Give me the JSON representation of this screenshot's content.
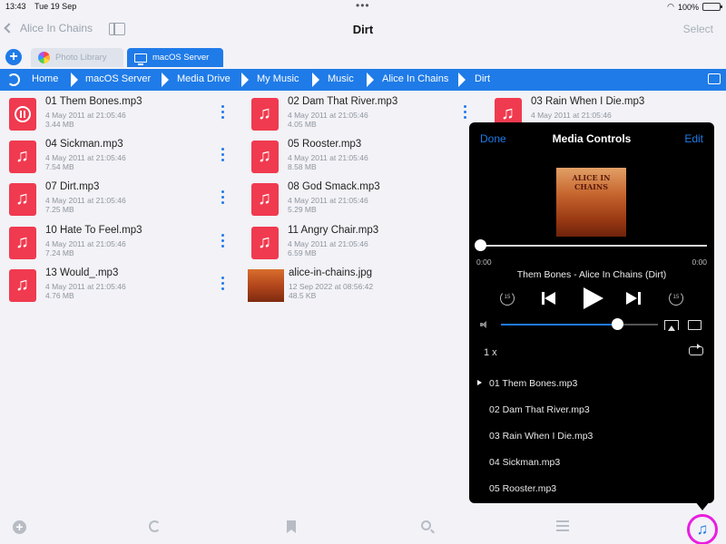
{
  "status": {
    "time": "13:43",
    "date": "Tue 19 Sep",
    "battery": "100%",
    "battery_level": 1.0
  },
  "nav": {
    "back_label": "Alice In Chains",
    "title": "Dirt",
    "select_label": "Select"
  },
  "tabs": [
    {
      "label": "Photo Library",
      "active": false
    },
    {
      "label": "macOS Server",
      "active": true
    }
  ],
  "breadcrumb": [
    "Home",
    "macOS Server",
    "Media Drive",
    "My Music",
    "Music",
    "Alice In Chains",
    "Dirt"
  ],
  "files": [
    {
      "name": "01 Them Bones.mp3",
      "date": "4 May 2011 at 21:05:46",
      "size": "3.44 MB",
      "type": "audio",
      "playing": true
    },
    {
      "name": "02 Dam That River.mp3",
      "date": "4 May 2011 at 21:05:46",
      "size": "4.05 MB",
      "type": "audio"
    },
    {
      "name": "03 Rain When I Die.mp3",
      "date": "4 May 2011 at 21:05:46",
      "size": "",
      "type": "audio"
    },
    {
      "name": "04 Sickman.mp3",
      "date": "4 May 2011 at 21:05:46",
      "size": "7.54 MB",
      "type": "audio"
    },
    {
      "name": "05 Rooster.mp3",
      "date": "4 May 2011 at 21:05:46",
      "size": "8.58 MB",
      "type": "audio"
    },
    {
      "name": "07 Dirt.mp3",
      "date": "4 May 2011 at 21:05:46",
      "size": "7.25 MB",
      "type": "audio"
    },
    {
      "name": "08 God Smack.mp3",
      "date": "4 May 2011 at 21:05:46",
      "size": "5.29 MB",
      "type": "audio"
    },
    {
      "name": "10 Hate To Feel.mp3",
      "date": "4 May 2011 at 21:05:46",
      "size": "7.24 MB",
      "type": "audio"
    },
    {
      "name": "11 Angry Chair.mp3",
      "date": "4 May 2011 at 21:05:46",
      "size": "6.59 MB",
      "type": "audio"
    },
    {
      "name": "13 Would_.mp3",
      "date": "4 May 2011 at 21:05:46",
      "size": "4.76 MB",
      "type": "audio"
    },
    {
      "name": "alice-in-chains.jpg",
      "date": "12 Sep 2022 at 08:56:42",
      "size": "48.5 KB",
      "type": "image"
    }
  ],
  "media": {
    "done_label": "Done",
    "title": "Media Controls",
    "edit_label": "Edit",
    "album_art_text": "ALICE IN CHAINS",
    "time_start": "0:00",
    "time_end": "0:00",
    "now_playing": "Them Bones - Alice In Chains (Dirt)",
    "skip_back_label": "15",
    "skip_forward_label": "15",
    "volume_level": 0.74,
    "speed": "1 x",
    "queue": [
      "01 Them Bones.mp3",
      "02 Dam That River.mp3",
      "03 Rain When I Die.mp3",
      "04 Sickman.mp3",
      "05 Rooster.mp3"
    ],
    "current_index": 0
  },
  "toolbar_icons": [
    "add-icon",
    "refresh-icon",
    "bookmark-icon",
    "search-icon",
    "sort-icon",
    "music-note-icon"
  ]
}
